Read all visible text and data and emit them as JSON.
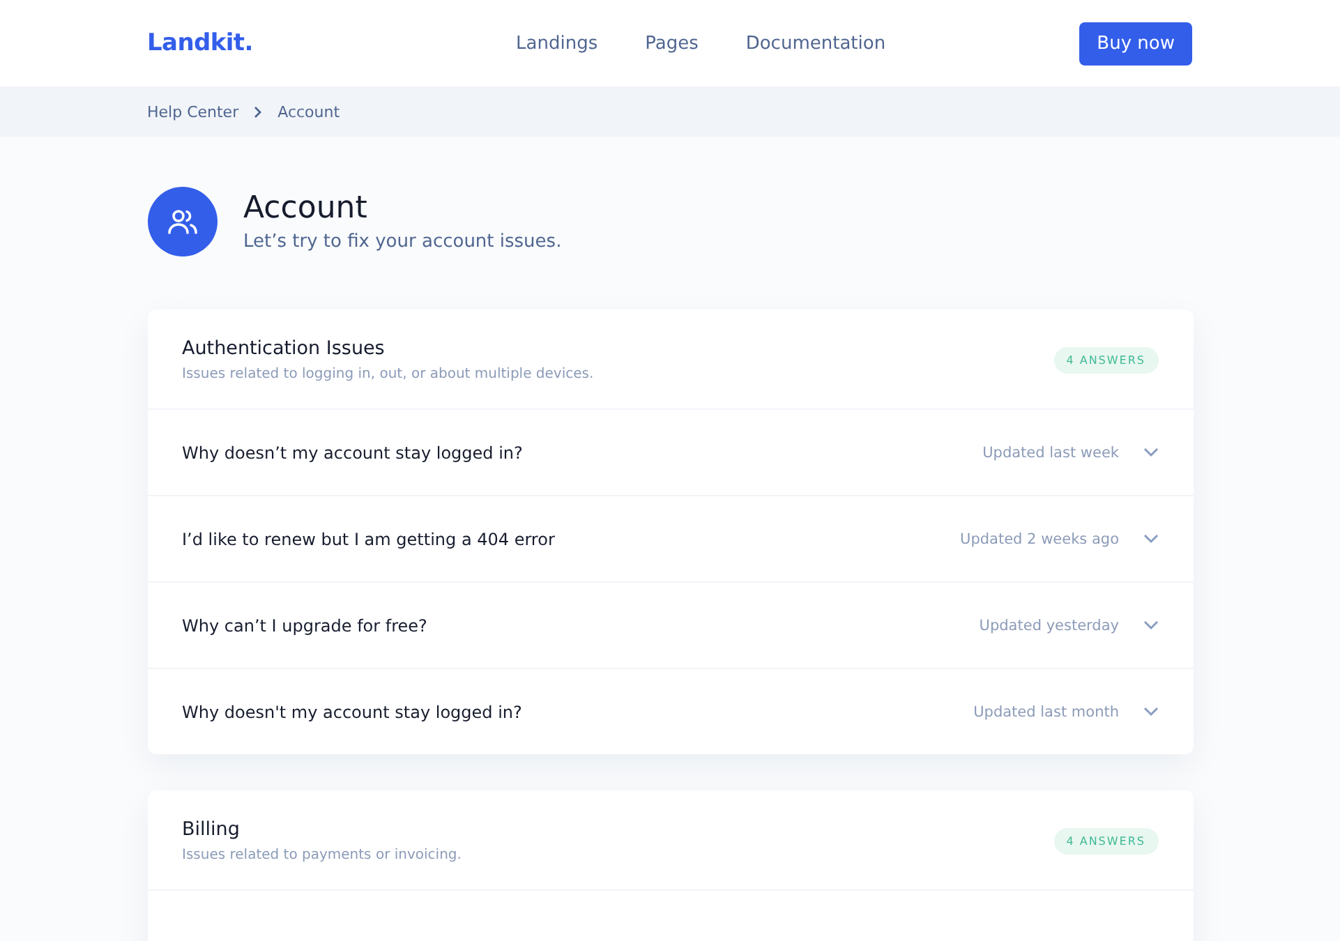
{
  "navbar": {
    "brand": "Landkit.",
    "links": [
      "Landings",
      "Pages",
      "Documentation"
    ],
    "button": "Buy now"
  },
  "breadcrumb": [
    "Help Center",
    "Account"
  ],
  "header": {
    "title": "Account",
    "subtitle": "Let’s try to fix your account issues."
  },
  "sections": [
    {
      "title": "Authentication Issues",
      "description": "Issues related to logging in, out, or about multiple devices.",
      "badge": "4 ANSWERS",
      "questions": [
        {
          "question": "Why doesn’t my account stay logged in?",
          "updated": "Updated last week"
        },
        {
          "question": "I’d like to renew but I am getting a 404 error",
          "updated": "Updated 2 weeks ago"
        },
        {
          "question": "Why can’t I upgrade for free?",
          "updated": "Updated yesterday"
        },
        {
          "question": "Why doesn't my account stay logged in?",
          "updated": "Updated last month"
        }
      ]
    },
    {
      "title": "Billing",
      "description": "Issues related to payments or invoicing.",
      "badge": "4 ANSWERS"
    }
  ]
}
